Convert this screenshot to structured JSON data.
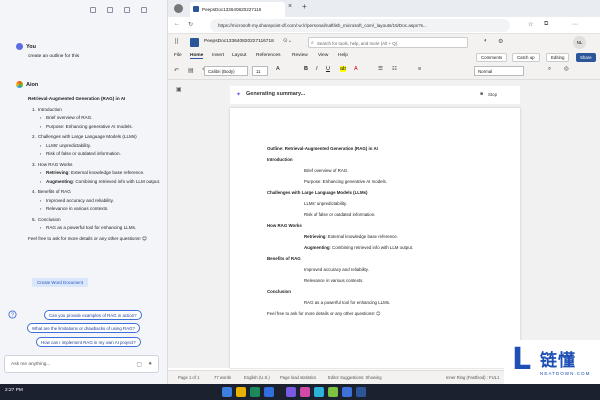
{
  "sidebar": {
    "user_name": "You",
    "user_message": "create an outline for this",
    "bot_name": "Aion",
    "title": "Retrieval-Augmented Generation (RAG) in AI",
    "sections": [
      {
        "num": "1.",
        "heading": "Introduction",
        "bullets": [
          [
            "",
            "Brief overview of RAG."
          ],
          [
            "",
            "Purpose: Enhancing generative AI models."
          ]
        ]
      },
      {
        "num": "2.",
        "heading": "Challenges with Large Language Models (LLMs)",
        "bullets": [
          [
            "",
            "LLMs' unpredictability."
          ],
          [
            "",
            "Risk of false or outdated information."
          ]
        ]
      },
      {
        "num": "3.",
        "heading": "How RAG Works",
        "bullets": [
          [
            "Retrieving",
            ": External knowledge base reference."
          ],
          [
            "Augmenting",
            ": Combining retrieved info with LLM output."
          ]
        ]
      },
      {
        "num": "4.",
        "heading": "Benefits of RAG",
        "bullets": [
          [
            "",
            "Improved accuracy and reliability."
          ],
          [
            "",
            "Relevance in various contexts."
          ]
        ]
      },
      {
        "num": "5.",
        "heading": "Conclusion",
        "bullets": [
          [
            "",
            "RAG as a powerful tool for enhancing LLMs."
          ]
        ]
      }
    ],
    "closing": "Feel free to ask for more details or any other questions! 😊",
    "create_button": "Create Word Document",
    "suggestions": [
      "Can you provide examples of RAG in action?",
      "What are the limitations or drawbacks of using RAG?",
      "How can I implement RAG in my own AI project?"
    ],
    "ask_placeholder": "Ask me anything..."
  },
  "browser": {
    "tab_title": "PeepsDoc133640820227116",
    "url": "https://microsoft-my.sharepoint-df.com/:w:/r/personal/naftlish_microsoft_com/_layouts/15/Doc.aspx?s..."
  },
  "word": {
    "doc_title": "PeepsDoc133640820227116718",
    "search_placeholder": "Search for tools, help, and more (Alt + Q)",
    "user_initials": "NL",
    "menu": [
      "File",
      "Home",
      "Insert",
      "Layout",
      "References",
      "Review",
      "View",
      "Help"
    ],
    "active_menu": "Home",
    "comments_label": "Comments",
    "catchup_label": "Catch up",
    "editing_label": "Editing",
    "share_label": "Share",
    "font_name": "Calibri (Body)",
    "font_size": "11",
    "style_name": "Normal",
    "generating_label": "Generating summary...",
    "stop_label": "Stop",
    "document": [
      {
        "type": "title",
        "text": "Outline: Retrieval-Augmented Generation (RAG) in AI"
      },
      {
        "type": "heading",
        "text": "Introduction"
      },
      {
        "type": "bullet",
        "text": "Brief overview of RAG."
      },
      {
        "type": "bullet",
        "text": "Purpose: Enhancing generative AI models."
      },
      {
        "type": "heading",
        "text": "Challenges with Large Language Models (LLMs)"
      },
      {
        "type": "bullet",
        "text": "LLMs' unpredictability."
      },
      {
        "type": "bullet",
        "text": "Risk of false or outdated information."
      },
      {
        "type": "heading",
        "text": "How RAG Works"
      },
      {
        "type": "bullet",
        "bold": "Retrieving",
        "text": ": External knowledge base reference."
      },
      {
        "type": "bullet",
        "bold": "Augmenting",
        "text": ": Combining retrieved info with LLM output."
      },
      {
        "type": "heading",
        "text": "Benefits of RAG"
      },
      {
        "type": "bullet",
        "text": "Improved accuracy and reliability."
      },
      {
        "type": "bullet",
        "text": "Relevance in various contexts."
      },
      {
        "type": "heading",
        "text": "Conclusion"
      },
      {
        "type": "bullet",
        "text": "RAG as a powerful tool for enhancing LLMs."
      },
      {
        "type": "para",
        "text": "Feel free to ask for more details or any other questions! 😊"
      }
    ],
    "status": {
      "page": "Page 1 of 1",
      "words": "77 words",
      "language": "English (U.S.)",
      "page_load": "Page load statistics",
      "editor": "Editor Suggestions: Showing",
      "inner_ring": "Inner Ring (Fastfood) : FUL1"
    }
  },
  "taskbar": {
    "time": "2:27 PM"
  },
  "watermark": {
    "letter": "L",
    "chinese": "链懂",
    "sub": "NEATDOWN.COM"
  },
  "colors": {
    "accent": "#2b579a",
    "copilot_blue": "#3e6fd8"
  }
}
